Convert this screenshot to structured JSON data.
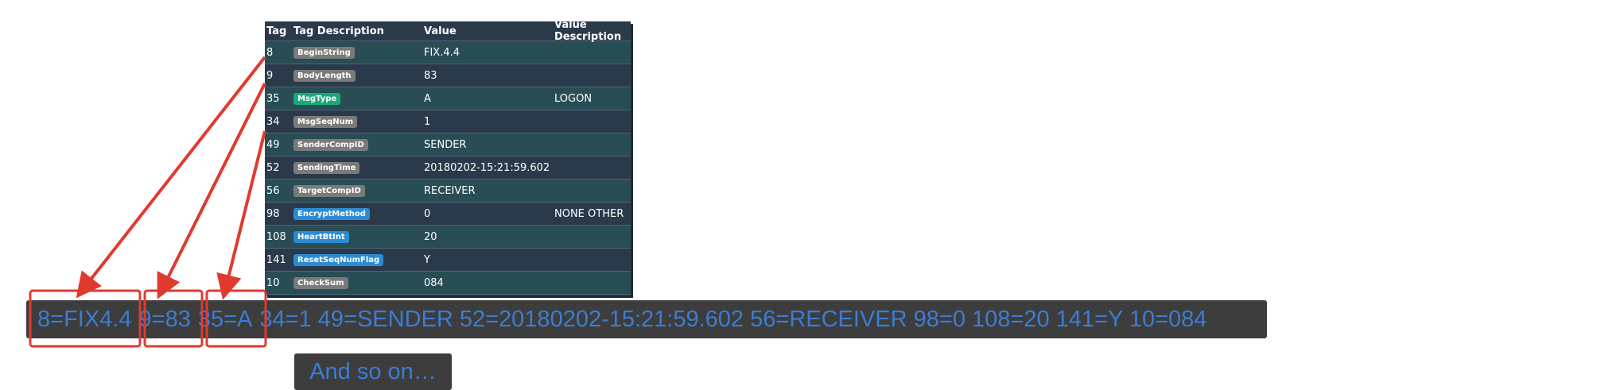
{
  "table": {
    "headers": {
      "tag": "Tag",
      "tag_description": "Tag Description",
      "value": "Value",
      "value_description": "Value Description"
    },
    "rows": [
      {
        "tag": "8",
        "desc": "BeginString",
        "badge_color": "gray",
        "value": "FIX.4.4",
        "value_desc": ""
      },
      {
        "tag": "9",
        "desc": "BodyLength",
        "badge_color": "gray",
        "value": "83",
        "value_desc": ""
      },
      {
        "tag": "35",
        "desc": "MsgType",
        "badge_color": "green",
        "value": "A",
        "value_desc": "LOGON"
      },
      {
        "tag": "34",
        "desc": "MsgSeqNum",
        "badge_color": "gray",
        "value": "1",
        "value_desc": ""
      },
      {
        "tag": "49",
        "desc": "SenderCompID",
        "badge_color": "gray",
        "value": "SENDER",
        "value_desc": ""
      },
      {
        "tag": "52",
        "desc": "SendingTime",
        "badge_color": "gray",
        "value": "20180202-15:21:59.602",
        "value_desc": ""
      },
      {
        "tag": "56",
        "desc": "TargetCompID",
        "badge_color": "gray",
        "value": "RECEIVER",
        "value_desc": ""
      },
      {
        "tag": "98",
        "desc": "EncryptMethod",
        "badge_color": "blue",
        "value": "0",
        "value_desc": "NONE OTHER"
      },
      {
        "tag": "108",
        "desc": "HeartBtInt",
        "badge_color": "blue",
        "value": "20",
        "value_desc": ""
      },
      {
        "tag": "141",
        "desc": "ResetSeqNumFlag",
        "badge_color": "blue",
        "value": "Y",
        "value_desc": ""
      },
      {
        "tag": "10",
        "desc": "CheckSum",
        "badge_color": "gray",
        "value": "084",
        "value_desc": ""
      }
    ]
  },
  "raw_message": {
    "seg1": "8=FIX4.4",
    "seg2": "9=83",
    "seg3": "35=A",
    "rest": "34=1 49=SENDER 52=20180202-15:21:59.602 56=RECEIVER 98=0 108=20 141=Y 10=084"
  },
  "and_so_on": "And so on…",
  "colors": {
    "table_bg": "#2b3a4a",
    "table_alt_row": "#294d55",
    "raw_text": "#3b7dd4",
    "highlight_red": "#e03a2f"
  }
}
